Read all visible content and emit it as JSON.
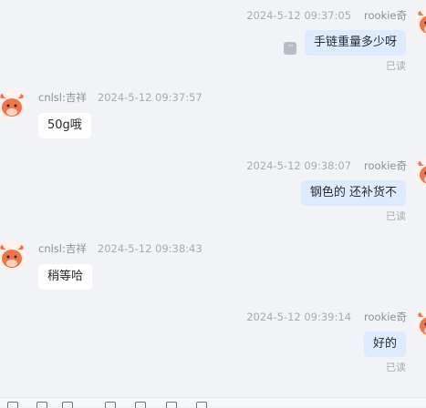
{
  "self_name": "rookie奇",
  "other_name": "cnlsl:吉祥",
  "read_label": "已读",
  "messages": [
    {
      "side": "self",
      "time": "2024-5-12 09:37:05",
      "text": "手链重量多少呀",
      "read": true
    },
    {
      "side": "other",
      "time": "2024-5-12 09:37:57",
      "text": "50g哦"
    },
    {
      "side": "self",
      "time": "2024-5-12 09:38:07",
      "text": "钢色的 还补货不",
      "read": true
    },
    {
      "side": "other",
      "time": "2024-5-12 09:38:43",
      "text": "稍等哈"
    },
    {
      "side": "self",
      "time": "2024-5-12 09:39:14",
      "text": "好的",
      "read": true
    }
  ],
  "icons": {
    "more": "more-icon",
    "avatar": "bull-mascot-avatar-icon"
  },
  "colors": {
    "self_bubble": "#deebff",
    "other_bubble": "#ffffff",
    "background": "#f2f3f7",
    "avatar": "#f0734a"
  }
}
